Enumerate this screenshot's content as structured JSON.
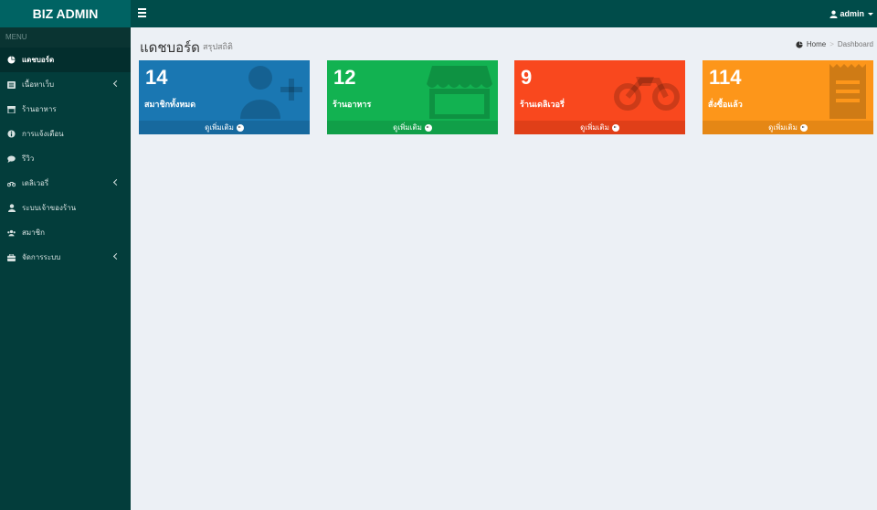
{
  "app": {
    "title": "BIZ ADMIN"
  },
  "topbar": {
    "user": "admin"
  },
  "sidebar": {
    "header": "MENU",
    "items": [
      {
        "label": "แดชบอร์ด",
        "icon": "dashboard-icon",
        "active": true,
        "submenu": false
      },
      {
        "label": "เนื้อหาเว็บ",
        "icon": "list-icon",
        "submenu": true
      },
      {
        "label": "ร้านอาหาร",
        "icon": "store-icon",
        "submenu": false
      },
      {
        "label": "การแจ้งเตือน",
        "icon": "info-icon",
        "submenu": false
      },
      {
        "label": "รีวิว",
        "icon": "comment-icon",
        "submenu": false
      },
      {
        "label": "เดลิเวอรี่",
        "icon": "motorcycle-icon",
        "submenu": true
      },
      {
        "label": "ระบบเจ้าของร้าน",
        "icon": "user-icon",
        "submenu": false
      },
      {
        "label": "สมาชิก",
        "icon": "users-icon",
        "submenu": false
      },
      {
        "label": "จัดการระบบ",
        "icon": "briefcase-icon",
        "submenu": true
      }
    ]
  },
  "page": {
    "title": "แดชบอร์ด",
    "subtitle": "สรุปสถิติ"
  },
  "breadcrumb": {
    "home": "Home",
    "current": "Dashboard"
  },
  "boxes": [
    {
      "number": "14",
      "label": "สมาชิกทั้งหมด",
      "footer": "ดูเพิ่มเติม",
      "icon": "user-plus-icon",
      "color": "#1a77b2",
      "footer_color": "#17699e"
    },
    {
      "number": "12",
      "label": "ร้านอาหาร",
      "footer": "ดูเพิ่มเติม",
      "icon": "store-icon",
      "color": "#12b251",
      "footer_color": "#109f48"
    },
    {
      "number": "9",
      "label": "ร้านเดลิเวอรี่",
      "footer": "ดูเพิ่มเติม",
      "icon": "motorcycle-icon",
      "color": "#f9481e",
      "footer_color": "#e03f18"
    },
    {
      "number": "114",
      "label": "สั่งซื้อแล้ว",
      "footer": "ดูเพิ่มเติม",
      "icon": "receipt-icon",
      "color": "#fd961a",
      "footer_color": "#e58715"
    }
  ]
}
